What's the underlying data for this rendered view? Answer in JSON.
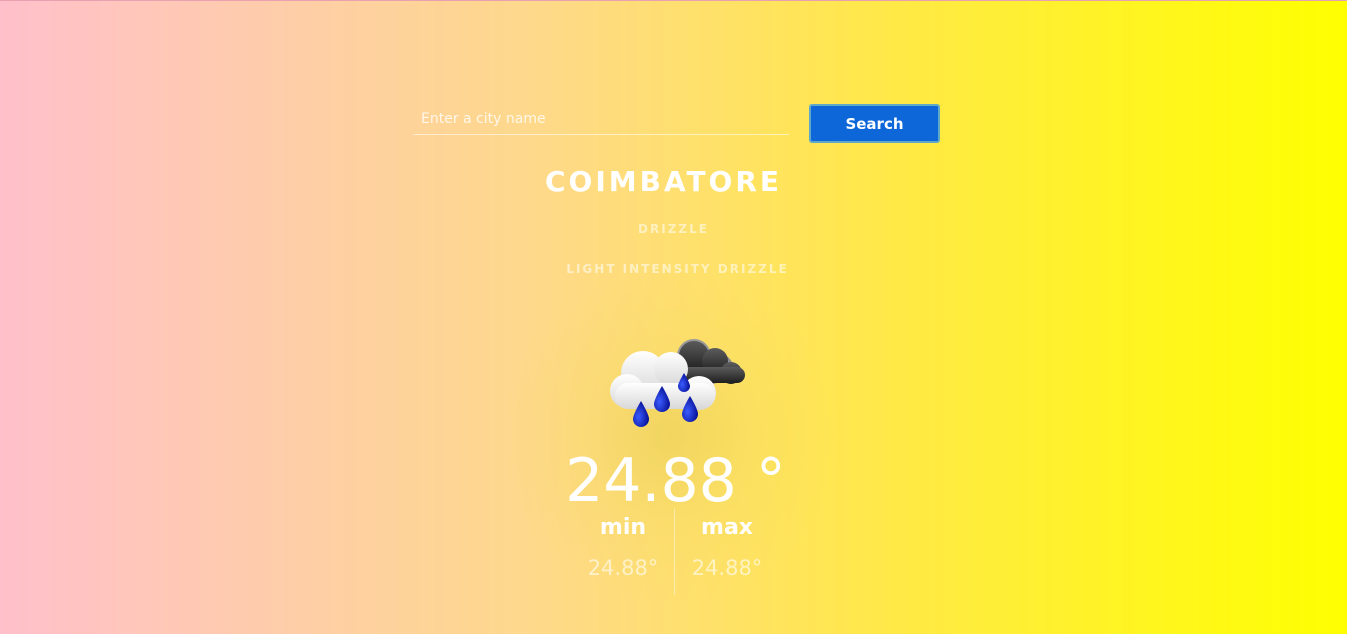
{
  "search": {
    "placeholder": "Enter a city name",
    "value": "",
    "button_label": "Search"
  },
  "weather": {
    "city": "COIMBATORE",
    "main": "DRIZZLE",
    "description": "LIGHT INTENSITY DRIZZLE",
    "icon": "rain-cloud-icon",
    "temperature": "24.88 °",
    "min_label": "min",
    "min_value": "24.88°",
    "max_label": "max",
    "max_value": "24.88°"
  },
  "colors": {
    "gradient_start": "#ffc0cb",
    "gradient_end": "#ffff00",
    "button": "#0d67d9",
    "rain_drop": "#0a1fb0"
  }
}
